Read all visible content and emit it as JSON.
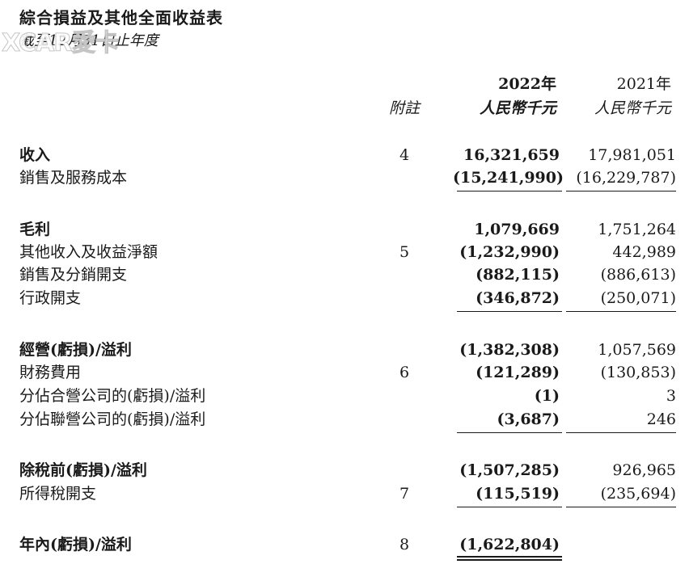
{
  "title": "綜合損益及其他全面收益表",
  "subtitle": "截至12月31日止年度",
  "watermark": "XCAR愛卡",
  "header": {
    "year_2022": "2022年",
    "year_2021": "2021年",
    "note": "附註",
    "unit_2022": "人民幣千元",
    "unit_2021": "人民幣千元"
  },
  "rows": [
    {
      "label": "收入",
      "note": "4",
      "v2022": "16,321,659",
      "v2021": "17,981,051"
    },
    {
      "label": "銷售及服務成本",
      "note": "",
      "v2022": "(15,241,990)",
      "v2021": "(16,229,787)"
    },
    {
      "label": "毛利",
      "note": "",
      "v2022": "1,079,669",
      "v2021": "1,751,264"
    },
    {
      "label": "其他收入及收益淨額",
      "note": "5",
      "v2022": "(1,232,990)",
      "v2021": "442,989"
    },
    {
      "label": "銷售及分銷開支",
      "note": "",
      "v2022": "(882,115)",
      "v2021": "(886,613)"
    },
    {
      "label": "行政開支",
      "note": "",
      "v2022": "(346,872)",
      "v2021": "(250,071)"
    },
    {
      "label": "經營(虧損)/溢利",
      "note": "",
      "v2022": "(1,382,308)",
      "v2021": "1,057,569"
    },
    {
      "label": "財務費用",
      "note": "6",
      "v2022": "(121,289)",
      "v2021": "(130,853)"
    },
    {
      "label": "分佔合營公司的(虧損)/溢利",
      "note": "",
      "v2022": "(1)",
      "v2021": "3"
    },
    {
      "label": "分佔聯營公司的(虧損)/溢利",
      "note": "",
      "v2022": "(3,687)",
      "v2021": "246"
    },
    {
      "label": "除稅前(虧損)/溢利",
      "note": "",
      "v2022": "(1,507,285)",
      "v2021": "926,965"
    },
    {
      "label": "所得稅開支",
      "note": "7",
      "v2022": "(115,519)",
      "v2021": "(235,694)"
    },
    {
      "label": "年內(虧損)/溢利",
      "note": "8",
      "v2022": "(1,622,804)",
      "v2021": ""
    }
  ]
}
